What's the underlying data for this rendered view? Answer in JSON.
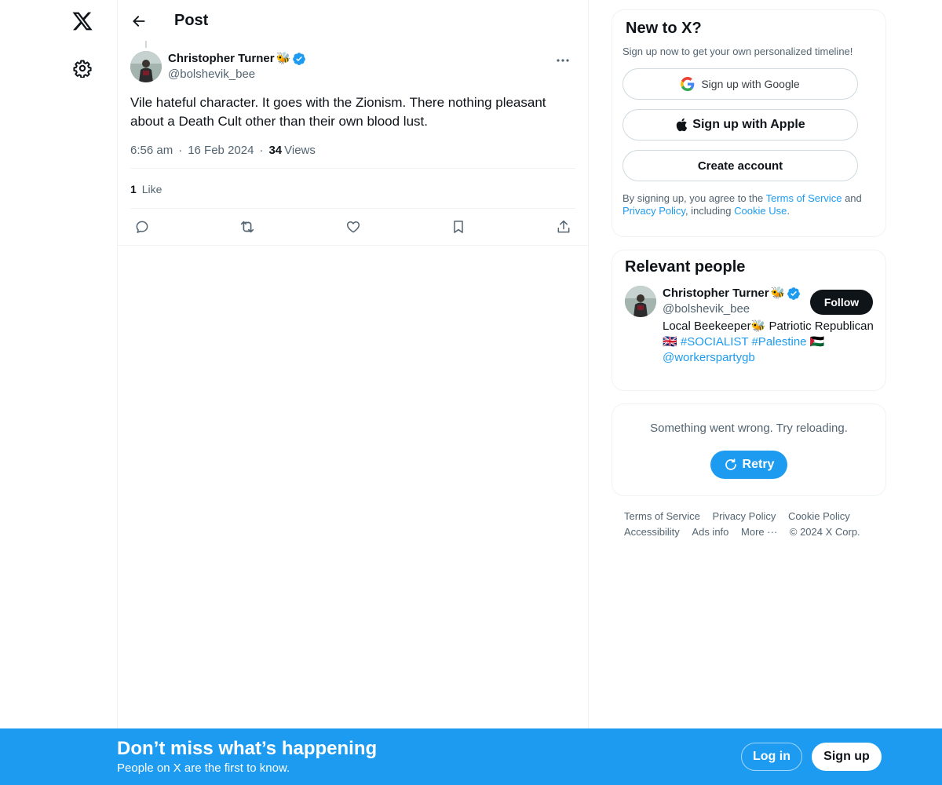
{
  "nav": {
    "logo_icon": "x-logo-icon",
    "settings_icon": "gear-icon"
  },
  "header": {
    "back_icon": "arrow-left-icon",
    "title": "Post"
  },
  "post": {
    "author_name": "Christopher Turner",
    "author_emoji": "🐝",
    "author_handle": "@bolshevik_bee",
    "text": "Vile hateful character. It goes with the Zionism. There nothing pleasant about a Death Cult other than their own blood lust.",
    "time": "6:56 am",
    "date": "16 Feb 2024",
    "views_count": "34",
    "views_label": "Views",
    "likes_count": "1",
    "likes_label": "Like",
    "actions": [
      "reply-icon",
      "repost-icon",
      "like-icon",
      "bookmark-icon",
      "share-icon"
    ]
  },
  "signup": {
    "title": "New to X?",
    "subtitle": "Sign up now to get your own personalized timeline!",
    "google_label": "Sign up with Google",
    "apple_label": "Sign up with Apple",
    "create_label": "Create account",
    "legal_prefix": "By signing up, you agree to the",
    "terms_link": "Terms of Service",
    "legal_and": "and",
    "privacy_link": "Privacy Policy",
    "legal_including": ", including",
    "cookie_link": "Cookie Use",
    "legal_end": "."
  },
  "relevant": {
    "title": "Relevant people",
    "name": "Christopher Turner",
    "emoji": "🐝",
    "handle": "@bolshevik_bee",
    "follow_label": "Follow",
    "bio_1": "Local Beekeeper",
    "bio_bee": "🐝",
    "bio_2": " Patriotic Republican ",
    "bio_flag_uk": "🇬🇧",
    "hashtag_1": "#SOCIALIST",
    "hashtag_2": "#Palestine",
    "bio_flag_ps": "🇵🇸",
    "mention": "@workerspartygb"
  },
  "error": {
    "text": "Something went wrong. Try reloading.",
    "retry_label": "Retry"
  },
  "footer": {
    "links": [
      "Terms of Service",
      "Privacy Policy",
      "Cookie Policy",
      "Accessibility",
      "Ads info",
      "More ···"
    ],
    "copyright": "© 2024 X Corp."
  },
  "bottom_bar": {
    "title": "Don’t miss what’s happening",
    "subtitle": "People on X are the first to know.",
    "login_label": "Log in",
    "signup_label": "Sign up"
  },
  "colors": {
    "accent": "#1d9bf0",
    "text": "#0f1419",
    "muted": "#536471",
    "border": "#eff3f4"
  }
}
